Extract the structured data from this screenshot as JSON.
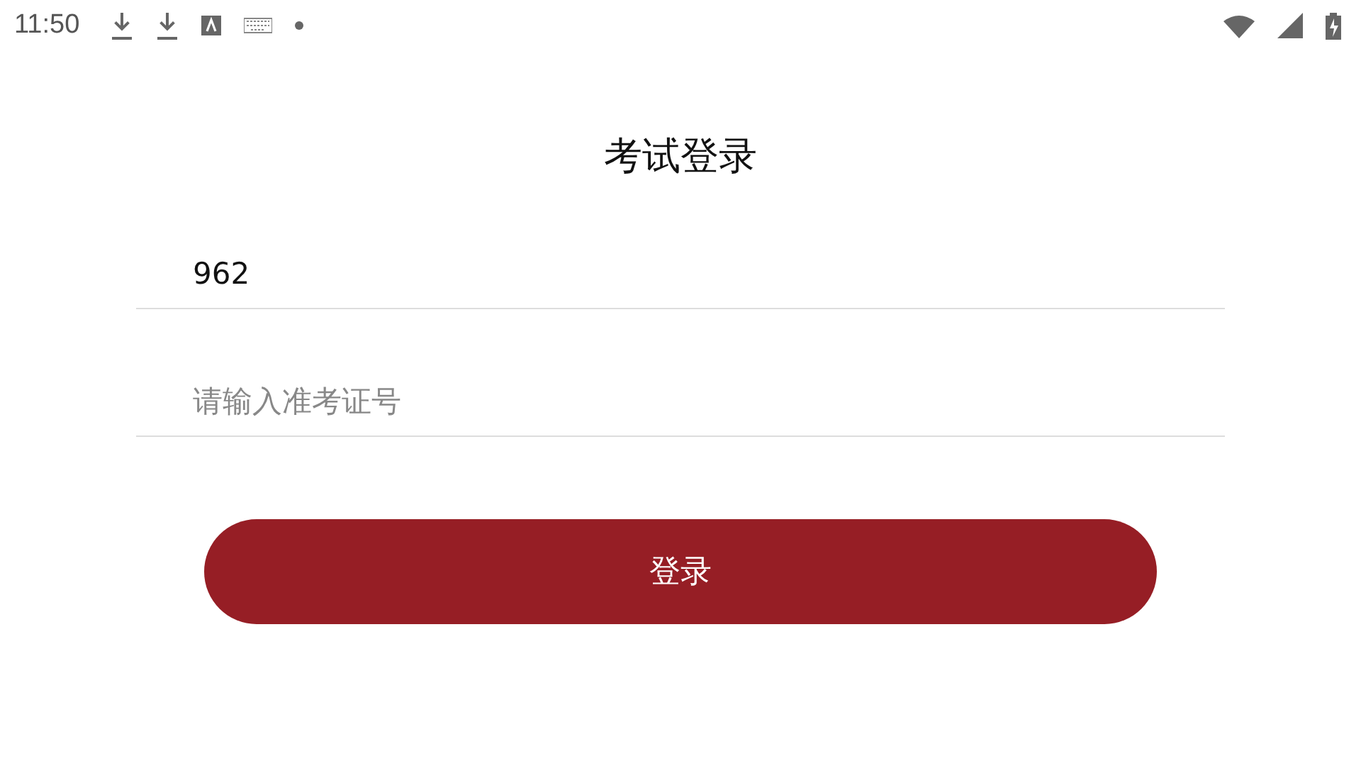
{
  "status_bar": {
    "time": "11:50"
  },
  "title": "考试登录",
  "fields": [
    {
      "value": "962"
    },
    {
      "placeholder": "请输入准考证号"
    }
  ],
  "login_button": "登录"
}
